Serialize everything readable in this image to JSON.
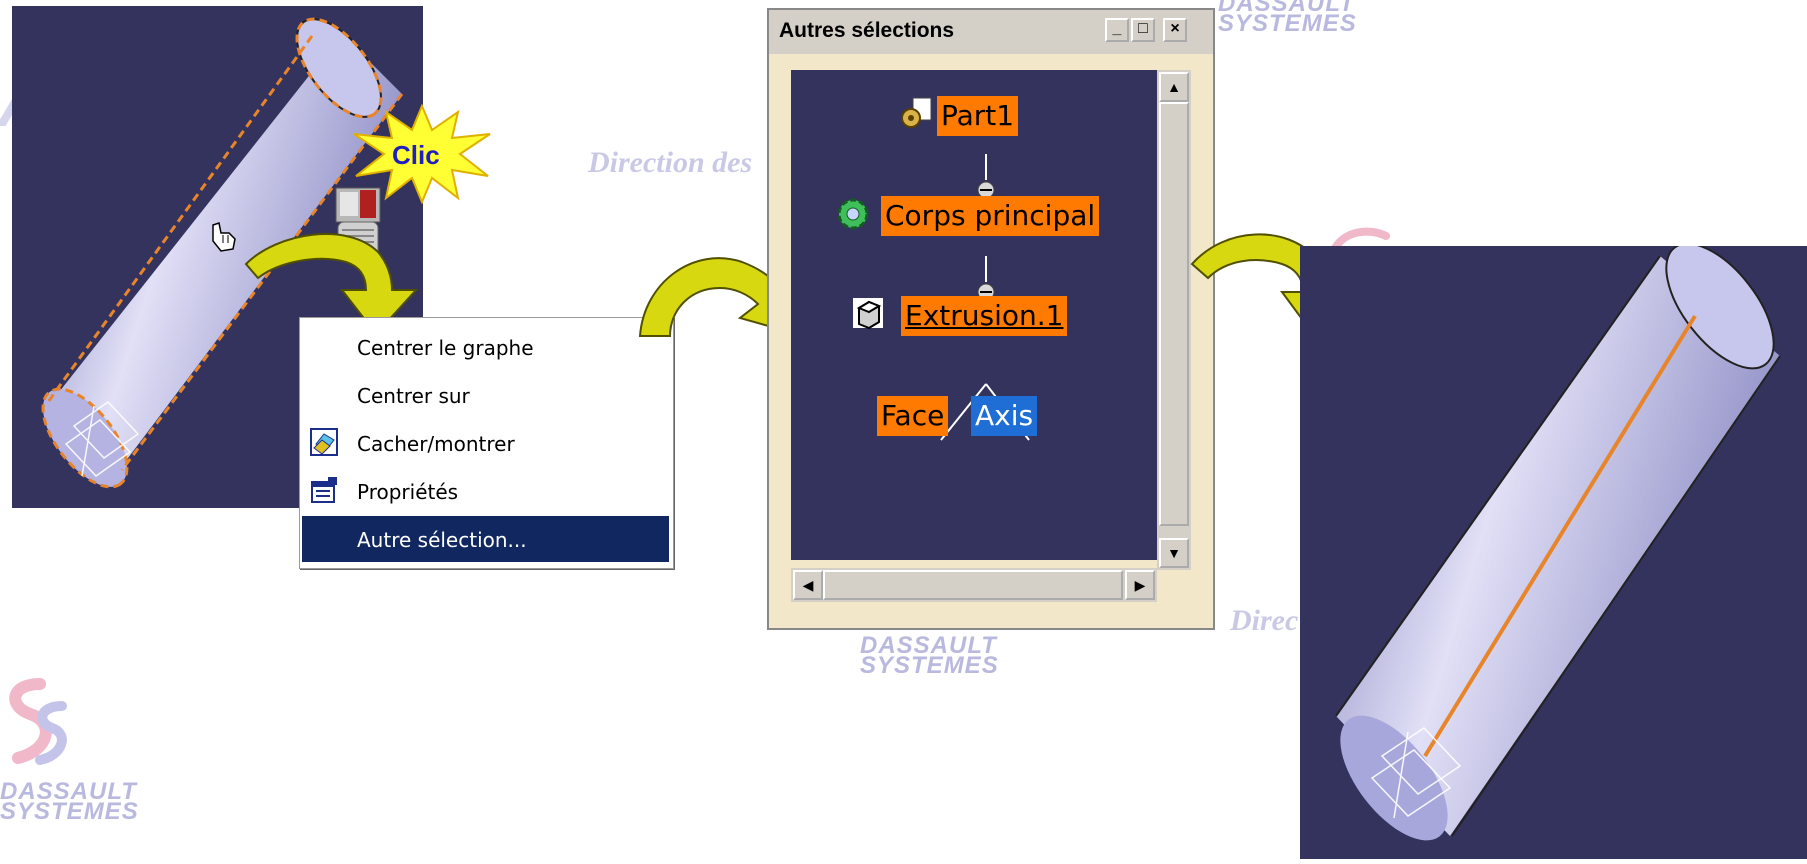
{
  "watermarks": {
    "direction": "Direction des",
    "direction_right": "Direc",
    "brand_line1": "DASSAULT",
    "brand_line2": "SYSTEMES"
  },
  "callout": {
    "clic": "Clic"
  },
  "context_menu": {
    "items": [
      {
        "label": "Centrer le graphe",
        "icon": "none",
        "selected": false
      },
      {
        "label": "Centrer sur",
        "icon": "none",
        "selected": false
      },
      {
        "label": "Cacher/montrer",
        "icon": "hide-show-icon",
        "selected": false
      },
      {
        "label": "Propriétés",
        "icon": "properties-icon",
        "selected": false
      },
      {
        "label": "Autre sélection...",
        "icon": "none",
        "selected": true
      }
    ]
  },
  "dialog": {
    "title": "Autres sélections",
    "window_buttons": {
      "minimize": "_",
      "maximize": "□",
      "close": "×"
    },
    "tree": {
      "root": "Part1",
      "body": "Corps principal",
      "feature": "Extrusion.1",
      "children": [
        "Face",
        "Axis"
      ]
    }
  },
  "colors": {
    "viewport": "#33335e",
    "node_highlight": "#ff7a00",
    "node_selected": "#1e6ed6",
    "menu_selection": "#11275f",
    "axis_line": "#e8852a"
  }
}
